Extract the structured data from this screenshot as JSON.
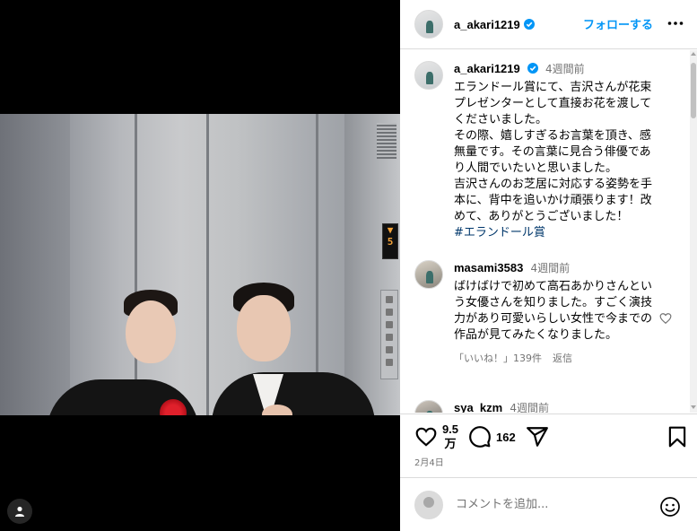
{
  "post": {
    "username": "a_akari1219",
    "follow_label": "フォローする",
    "verified": true
  },
  "caption": {
    "username": "a_akari1219",
    "ago": "4週間前",
    "text": "エランドール賞にて、吉沢さんが花束プレゼンターとして直接お花を渡してくださいました。\nその際、嬉しすぎるお言葉を頂き、感無量です。その言葉に見合う俳優であり人間でいたいと思いました。\n吉沢さんのお芝居に対応する姿勢を手本に、背中を追いかけ頑張ります！改めて、ありがとうございました！",
    "hashtag": "#エランドール賞"
  },
  "comments": [
    {
      "username": "masami3583",
      "ago": "4週間前",
      "text": "ばけばけで初めて高石あかりさんという女優さんを知りました。すごく演技力があり可愛いらしい女性で今までの作品が見てみたくなりました。",
      "likes_label": "「いいね！」139件",
      "reply_label": "返信"
    },
    {
      "username": "sya_kzm",
      "ago": "4週間前"
    }
  ],
  "actions": {
    "likes_line1": "9.5",
    "likes_line2": "万",
    "comments_count": "162",
    "date": "2月4日"
  },
  "composer": {
    "placeholder": "コメントを追加..."
  },
  "photo": {
    "floor_display": "5"
  },
  "colors": {
    "accent": "#0095f6",
    "muted": "#737373",
    "divider": "#dbdbdb",
    "hashtag": "#00376b"
  },
  "icons": {
    "verified": "verified-badge-icon",
    "more": "more-horizontal-icon",
    "like": "heart-icon",
    "comment": "comment-bubble-icon",
    "share": "paper-plane-icon",
    "save": "bookmark-icon",
    "emoji": "smiley-face-icon",
    "tag": "user-tag-icon"
  }
}
